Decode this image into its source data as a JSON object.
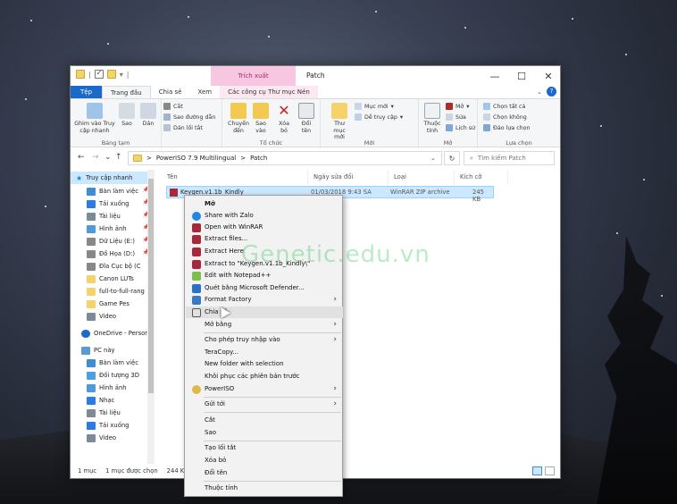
{
  "titlebar": {
    "context_tab_header": "Trích xuất",
    "window_title": "Patch",
    "minimize": "—",
    "maximize": "☐",
    "close": "✕"
  },
  "ribbon_tabs": {
    "file": "Tệp",
    "home": "Trang đầu",
    "share": "Chia sẻ",
    "view": "Xem",
    "compressed_tools": "Các công cụ Thư mục Nén"
  },
  "ribbon": {
    "clipboard": {
      "pin_quick_access": "Ghim vào Truy cập nhanh",
      "copy": "Sao",
      "paste": "Dán",
      "cut": "Cắt",
      "copy_path": "Sao đường dẫn",
      "paste_shortcut": "Dán lối tắt",
      "label": "Bảng tạm"
    },
    "organize": {
      "move_to": "Chuyển đến",
      "copy_to": "Sao vào",
      "delete": "Xóa bỏ",
      "rename": "Đổi tên",
      "label": "Tổ chức"
    },
    "new": {
      "new_folder": "Thư mục mới",
      "new_item": "Mục mới",
      "easy_access": "Dễ truy cập",
      "label": "Mới"
    },
    "open": {
      "properties": "Thuộc tính",
      "open": "Mở",
      "edit": "Sửa",
      "history": "Lịch sử",
      "label": "Mở"
    },
    "select": {
      "select_all": "Chọn tất cả",
      "select_none": "Chọn không",
      "invert": "Đảo lựa chọn",
      "label": "Lựa chọn"
    }
  },
  "address": {
    "path_part1": "PowerISO 7.9 Multilingual",
    "sep": ">",
    "path_part2": "Patch",
    "search_placeholder": "Tìm kiếm Patch"
  },
  "nav": {
    "quick_access": "Truy cập nhanh",
    "items": [
      {
        "label": "Bàn làm việc",
        "color": "#3c8fd6"
      },
      {
        "label": "Tải xuống",
        "color": "#2a7de1"
      },
      {
        "label": "Tài liệu",
        "color": "#7f8a99"
      },
      {
        "label": "Hình ảnh",
        "color": "#4e9bd9"
      },
      {
        "label": "Dữ Liệu (E:)",
        "color": "#888888"
      },
      {
        "label": "Đồ Họa (D:)",
        "color": "#888888"
      },
      {
        "label": "Đĩa Cục bộ (C",
        "color": "#888888"
      },
      {
        "label": "Canon LUTs",
        "color": "#f6d26b"
      },
      {
        "label": "full-to-full-rang",
        "color": "#f6d26b"
      },
      {
        "label": "Game Pes",
        "color": "#f6d26b"
      },
      {
        "label": "Video",
        "color": "#7f8a99"
      }
    ],
    "onedrive": "OneDrive - Person",
    "this_pc": "PC này",
    "pc_items": [
      {
        "label": "Bàn làm việc",
        "color": "#3c8fd6"
      },
      {
        "label": "Đối tượng 3D",
        "color": "#4ba0e0"
      },
      {
        "label": "Hình ảnh",
        "color": "#4e9bd9"
      },
      {
        "label": "Nhạc",
        "color": "#2a7de1"
      },
      {
        "label": "Tài liệu",
        "color": "#7f8a99"
      },
      {
        "label": "Tải xuống",
        "color": "#2a7de1"
      },
      {
        "label": "Video",
        "color": "#7f8a99"
      }
    ]
  },
  "columns": {
    "name": "Tên",
    "modified": "Ngày sửa đổi",
    "type": "Loại",
    "size": "Kích cỡ"
  },
  "file": {
    "name": "Keygen.v1.1b_Kindly",
    "modified": "01/03/2018 9:43 SA",
    "type": "WinRAR ZIP archive",
    "size": "245 KB"
  },
  "status": {
    "count": "1 mục",
    "selected": "1 mục được chọn",
    "size": "244 KB"
  },
  "context_menu": {
    "open": "Mở",
    "share_zalo": "Share with Zalo",
    "open_winrar": "Open with WinRAR",
    "extract_files": "Extract files...",
    "extract_here": "Extract Here",
    "extract_to": "Extract to \"Keygen.v1.1b_Kindly\\\"",
    "edit_notepad": "Edit with Notepad++",
    "scan_defender": "Quét bằng Microsoft Defender...",
    "format_factory": "Format Factory",
    "share": "Chia sẻ",
    "open_with": "Mở bằng",
    "give_access": "Cho phép truy nhập vào",
    "teracopy": "TeraCopy...",
    "new_folder_selection": "New folder with selection",
    "restore_versions": "Khôi phục các phiên bản trước",
    "poweriso": "PowerISO",
    "send_to": "Gửi tới",
    "cut": "Cắt",
    "copy": "Sao",
    "create_shortcut": "Tạo lối tắt",
    "delete": "Xóa bỏ",
    "rename": "Đổi tên",
    "properties": "Thuộc tính"
  },
  "watermark": "Genetic.edu.vn",
  "colors": {
    "accent": "#1b6ac9",
    "selection": "#cce8ff",
    "context_tab": "#f7c6e0",
    "watermark": "#28be50"
  }
}
